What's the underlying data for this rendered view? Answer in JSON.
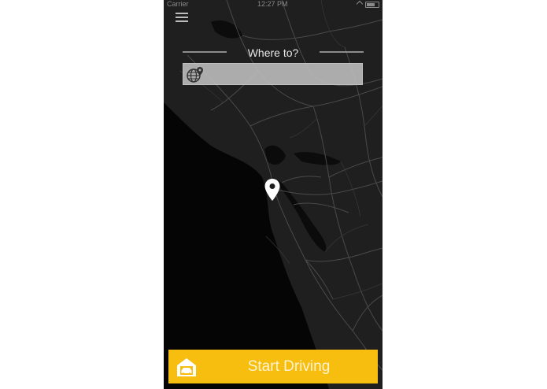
{
  "status_bar": {
    "carrier": "Carrier",
    "time": "12:27 PM"
  },
  "header": {
    "menu_icon": "hamburger-menu-icon"
  },
  "search": {
    "title": "Where to?",
    "placeholder": "",
    "value": "",
    "icon": "globe-pin-icon"
  },
  "map": {
    "marker_icon": "map-pin-icon"
  },
  "start_button": {
    "label": "Start Driving",
    "icon": "garage-car-icon",
    "color": "#f7be10"
  }
}
